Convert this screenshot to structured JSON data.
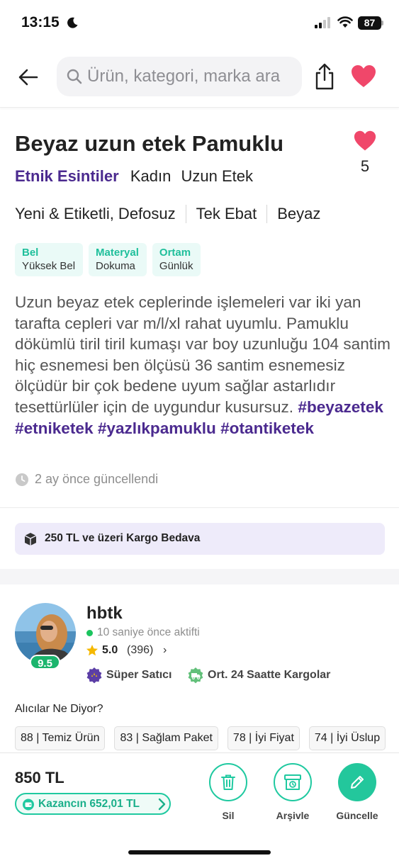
{
  "status_bar": {
    "time": "13:15",
    "battery": "87",
    "icons": [
      "moon-icon",
      "signal-icon",
      "wifi-icon",
      "battery-icon"
    ]
  },
  "search": {
    "placeholder": "Ürün, kategori, marka ara"
  },
  "colors": {
    "brand_purple": "#4b2a8f",
    "accent_green": "#1fc9a0",
    "heart_pink": "#f0476a",
    "online_green": "#1bc45e"
  },
  "product": {
    "title": "Beyaz uzun etek Pamuklu",
    "likes": "5",
    "brand": "Etnik Esintiler",
    "categories": [
      "Kadın",
      "Uzun Etek"
    ],
    "attributes": [
      "Yeni & Etiketli, Defosuz",
      "Tek Ebat",
      "Beyaz"
    ],
    "tags": [
      {
        "key": "Bel",
        "value": "Yüksek Bel"
      },
      {
        "key": "Materyal",
        "value": "Dokuma"
      },
      {
        "key": "Ortam",
        "value": "Günlük"
      }
    ],
    "description": "Uzun beyaz etek ceplerinde işlemeleri var iki yan tarafta cepleri var m/l/xl rahat uyumlu. Pamuklu dökümlü tiril tiril kumaşı var boy uzunluğu 104 santim hiç esnemesi ben ölçüsü 36 santim esnemesiz ölçüdür bir çok bedene uyum sağlar astarlıdır tesettürlüler için de uygundur kusursuz.",
    "hashtags": [
      "#beyazetek",
      "#etniketek",
      "#yazlıkpamuklu",
      "#otantiketek"
    ],
    "updated": "2 ay önce güncellendi"
  },
  "shipping": {
    "text": "250 TL ve üzeri Kargo Bedava"
  },
  "seller": {
    "name": "hbtk",
    "score": "9.5",
    "active": "10 saniye önce aktifti",
    "rating": "5.0",
    "rating_count": "(396)",
    "badges": [
      "Süper Satıcı",
      "Ort. 24 Saatte Kargolar"
    ]
  },
  "reviews": {
    "title": "Alıcılar Ne Diyor?",
    "chips": [
      "88 | Temiz Ürün",
      "83 | Sağlam Paket",
      "78 | İyi Fiyat",
      "74 | İyi Üslup"
    ]
  },
  "bottom": {
    "price": "850 TL",
    "earnings": "Kazancın 652,01 TL",
    "actions": [
      "Sil",
      "Arşivle",
      "Güncelle"
    ]
  }
}
